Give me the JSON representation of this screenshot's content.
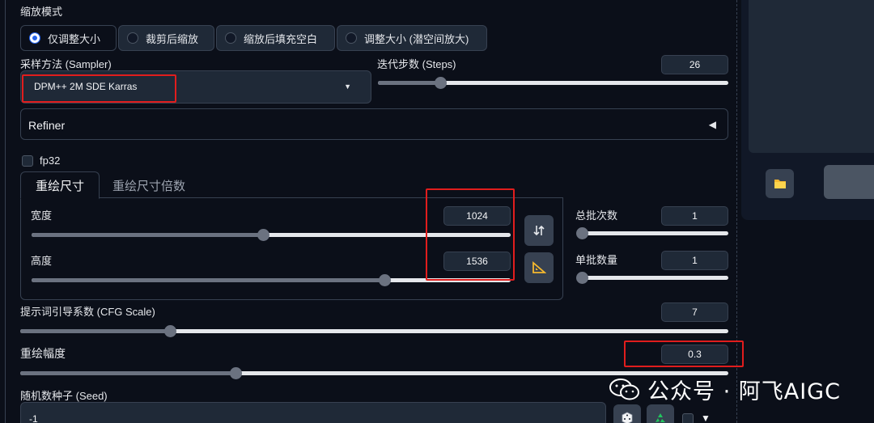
{
  "resize_mode": {
    "label": "缩放模式",
    "options": [
      "仅调整大小",
      "裁剪后缩放",
      "缩放后填充空白",
      "调整大小 (潜空间放大)"
    ],
    "selected": "仅调整大小"
  },
  "sampler": {
    "label": "采样方法 (Sampler)",
    "value": "DPM++ 2M SDE Karras"
  },
  "steps": {
    "label": "迭代步数 (Steps)",
    "value": "26",
    "fraction": 0.17
  },
  "refiner": {
    "label": "Refiner",
    "icon": "triangle-left-icon"
  },
  "fp32": {
    "label": "fp32",
    "checked": false
  },
  "tabs": [
    "重绘尺寸",
    "重绘尺寸倍数"
  ],
  "width": {
    "label": "宽度",
    "value": "1024",
    "fraction": 0.48
  },
  "height": {
    "label": "高度",
    "value": "1536",
    "fraction": 0.74
  },
  "batch_count": {
    "label": "总批次数",
    "value": "1",
    "fraction": 0.0
  },
  "batch_size": {
    "label": "单批数量",
    "value": "1",
    "fraction": 0.0
  },
  "cfg_scale": {
    "label": "提示词引导系数 (CFG Scale)",
    "value": "7",
    "fraction": 0.2
  },
  "denoising": {
    "label": "重绘幅度",
    "value": "0.3",
    "fraction": 0.3
  },
  "seed": {
    "label": "随机数种子 (Seed)",
    "value": "-1"
  },
  "icons": {
    "swap": "swap-vertical-icon",
    "ratio": "triangle-ruler-icon",
    "folder": "folder-icon",
    "dice": "dice-icon",
    "recycle": "recycle-icon",
    "dropdown": "chevron-down-icon"
  },
  "watermark": {
    "text": "公众号 · 阿飞AIGC"
  },
  "colors": {
    "accent": "#2563eb",
    "highlight": "#e11d1d",
    "background": "#0b0f19"
  }
}
